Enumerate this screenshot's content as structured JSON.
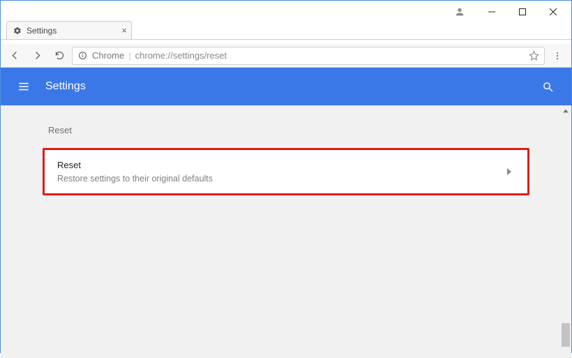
{
  "window": {
    "tab_title": "Settings"
  },
  "addressbar": {
    "origin_label": "Chrome",
    "url": "chrome://settings/reset"
  },
  "header": {
    "title": "Settings"
  },
  "section": {
    "label": "Reset",
    "card": {
      "title": "Reset",
      "description": "Restore settings to their original defaults"
    }
  },
  "colors": {
    "accent": "#3b78e7",
    "highlight_border": "#e11b1b"
  }
}
